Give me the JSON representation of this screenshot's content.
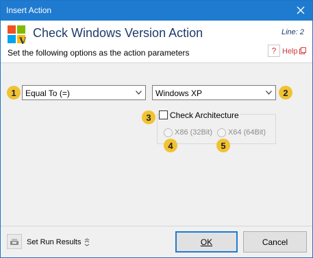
{
  "window": {
    "title": "Insert Action"
  },
  "header": {
    "action_title": "Check Windows Version Action",
    "line": "Line: 2",
    "subtitle": "Set the following options as the action parameters",
    "help_label": "Help"
  },
  "params": {
    "operator": {
      "value": "Equal To (=)",
      "step": "1"
    },
    "version": {
      "value": "Windows XP",
      "step": "2"
    },
    "check_architecture": {
      "label": "Check Architecture",
      "checked": false,
      "step": "3"
    },
    "x86": {
      "label": "X86 (32Bit)",
      "step": "4",
      "enabled": false
    },
    "x64": {
      "label": "X64 (64Bit)",
      "step": "5",
      "enabled": false
    }
  },
  "footer": {
    "set_run_results": "Set Run Results",
    "ok_label": "OK",
    "cancel_label": "Cancel"
  },
  "colors": {
    "titlebar": "#1f7bd0",
    "badge": "#f1c232",
    "help": "#d23a3a"
  }
}
